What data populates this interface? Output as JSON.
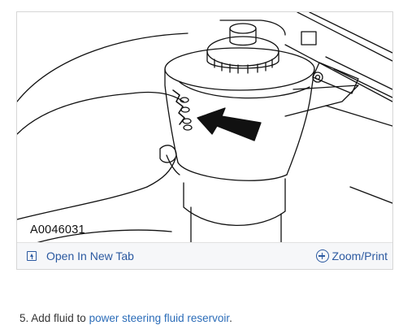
{
  "figure": {
    "id_label": "A0046031",
    "open_tab_label": "Open In New Tab",
    "zoom_label": "Zoom/Print",
    "icons": {
      "open_tab": "open-in-new-tab-icon",
      "zoom": "zoom-plus-icon"
    }
  },
  "step": {
    "prefix": "5. Add fluid to ",
    "link_text": "power steering fluid reservoir",
    "suffix": "."
  },
  "colors": {
    "link": "#2b6cb8",
    "toolbar_bg": "#f6f7f9",
    "toolbar_text": "#2b59a0"
  }
}
